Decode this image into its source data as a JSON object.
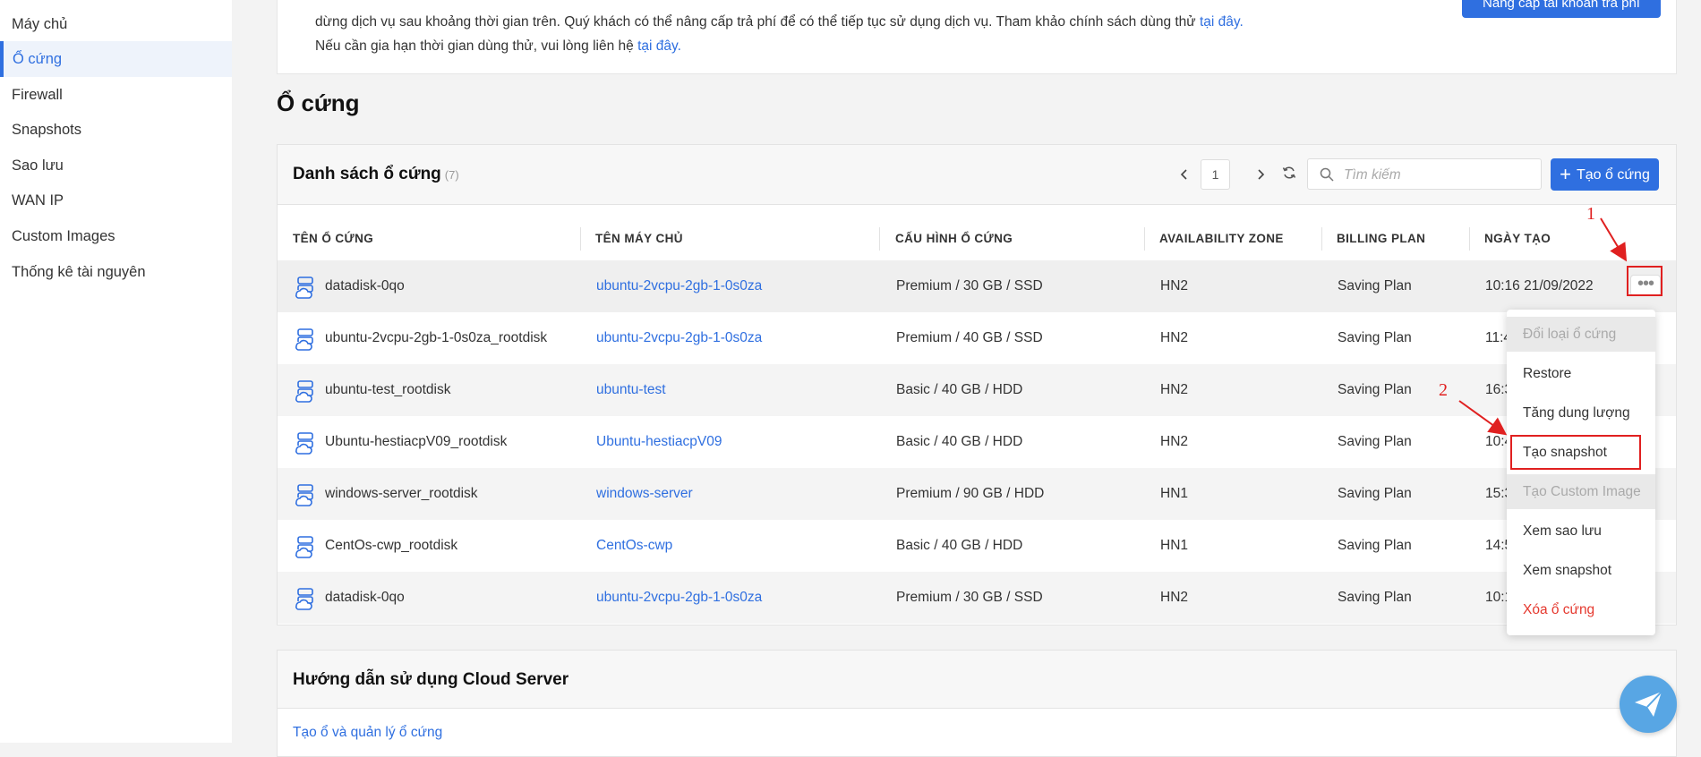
{
  "sidebar": {
    "items": [
      {
        "label": "Máy chủ",
        "active": false
      },
      {
        "label": "Ổ cứng",
        "active": true
      },
      {
        "label": "Firewall",
        "active": false
      },
      {
        "label": "Snapshots",
        "active": false
      },
      {
        "label": "Sao lưu",
        "active": false
      },
      {
        "label": "WAN IP",
        "active": false
      },
      {
        "label": "Custom Images",
        "active": false
      },
      {
        "label": "Thống kê tài nguyên",
        "active": false
      }
    ]
  },
  "notice": {
    "line1_text": "dừng dịch vụ sau khoảng thời gian trên. Quý khách có thể nâng cấp trả phí để có thể tiếp tục sử dụng dịch vụ. Tham khảo chính sách dùng thử ",
    "line1_link": "tại đây.",
    "line2_text": "Nếu cần gia hạn thời gian dùng thử, vui lòng liên hệ ",
    "line2_link": "tại đây.",
    "upgrade_button": "Nâng cấp tài khoản trả phí"
  },
  "page_title": "Ổ cứng",
  "list": {
    "title": "Danh sách ổ cứng",
    "count": "(7)",
    "page": "1",
    "search_placeholder": "Tìm kiếm",
    "create_button": "Tạo ổ cứng",
    "columns": [
      "TÊN Ổ CỨNG",
      "TÊN MÁY CHỦ",
      "CẤU HÌNH Ổ CỨNG",
      "AVAILABILITY ZONE",
      "BILLING PLAN",
      "NGÀY TẠO"
    ],
    "rows": [
      {
        "name": "datadisk-0qo",
        "server": "ubuntu-2vcpu-2gb-1-0s0za",
        "config": "Premium / 30 GB / SSD",
        "zone": "HN2",
        "plan": "Saving Plan",
        "created": "10:16 21/09/2022"
      },
      {
        "name": "ubuntu-2vcpu-2gb-1-0s0za_rootdisk",
        "server": "ubuntu-2vcpu-2gb-1-0s0za",
        "config": "Premium / 40 GB / SSD",
        "zone": "HN2",
        "plan": "Saving Plan",
        "created": "11:4"
      },
      {
        "name": "ubuntu-test_rootdisk",
        "server": "ubuntu-test",
        "config": "Basic / 40 GB / HDD",
        "zone": "HN2",
        "plan": "Saving Plan",
        "created": "16:3"
      },
      {
        "name": "Ubuntu-hestiacpV09_rootdisk",
        "server": "Ubuntu-hestiacpV09",
        "config": "Basic / 40 GB / HDD",
        "zone": "HN2",
        "plan": "Saving Plan",
        "created": "10:4"
      },
      {
        "name": "windows-server_rootdisk",
        "server": "windows-server",
        "config": "Premium / 90 GB / HDD",
        "zone": "HN1",
        "plan": "Saving Plan",
        "created": "15:3"
      },
      {
        "name": "CentOs-cwp_rootdisk",
        "server": "CentOs-cwp",
        "config": "Basic / 40 GB / HDD",
        "zone": "HN1",
        "plan": "Saving Plan",
        "created": "14:5"
      },
      {
        "name": "datadisk-0qo",
        "server": "ubuntu-2vcpu-2gb-1-0s0za",
        "config": "Premium / 30 GB / SSD",
        "zone": "HN2",
        "plan": "Saving Plan",
        "created": "10:1"
      }
    ]
  },
  "action_menu": {
    "items": [
      {
        "label": "Đổi loại ổ cứng",
        "state": "disabled"
      },
      {
        "label": "Restore",
        "state": "normal"
      },
      {
        "label": "Tăng dung lượng",
        "state": "normal"
      },
      {
        "label": "Tạo snapshot",
        "state": "highlighted"
      },
      {
        "label": "Tạo Custom Image",
        "state": "disabled"
      },
      {
        "label": "Xem sao lưu",
        "state": "normal"
      },
      {
        "label": "Xem snapshot",
        "state": "normal"
      },
      {
        "label": "Xóa ổ cứng",
        "state": "danger"
      }
    ]
  },
  "annotations": {
    "step1": "1",
    "step2": "2",
    "color": "#e02020"
  },
  "guide": {
    "title": "Hướng dẫn sử dụng Cloud Server",
    "link": "Tạo ổ và quản lý ổ cứng"
  },
  "colors": {
    "accent": "#2f6fe0",
    "danger": "#e5382e",
    "fab": "#58a6e4"
  },
  "icons": [
    "disk-icon",
    "search-icon",
    "chevron-left-icon",
    "chevron-right-icon",
    "refresh-icon",
    "plus-icon",
    "more-dots-icon",
    "send-icon"
  ]
}
